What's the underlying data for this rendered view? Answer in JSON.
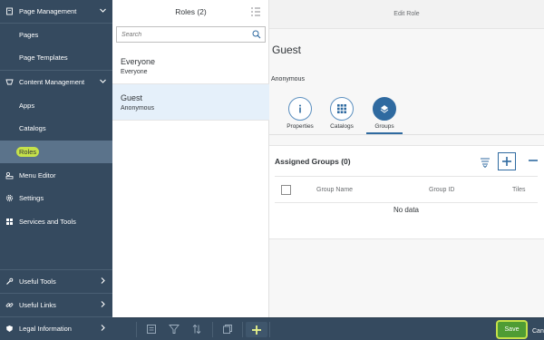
{
  "nav": {
    "items": [
      {
        "label": "Page Management",
        "icon": "page-icon",
        "type": "group",
        "expanded": true
      },
      {
        "label": "Pages",
        "type": "sub"
      },
      {
        "label": "Page Templates",
        "type": "sub"
      },
      {
        "label": "Content Management",
        "icon": "content-icon",
        "type": "group",
        "expanded": true
      },
      {
        "label": "Apps",
        "type": "sub"
      },
      {
        "label": "Catalogs",
        "type": "sub"
      },
      {
        "label": "Roles",
        "type": "sub",
        "active": true
      },
      {
        "label": "Menu Editor",
        "icon": "menu-editor-icon",
        "type": "item"
      },
      {
        "label": "Settings",
        "icon": "gear-icon",
        "type": "item"
      },
      {
        "label": "Services and Tools",
        "icon": "services-icon",
        "type": "item"
      }
    ],
    "bottom": [
      {
        "label": "Useful Tools",
        "icon": "wrench-icon"
      },
      {
        "label": "Useful Links",
        "icon": "link-icon"
      },
      {
        "label": "Legal Information",
        "icon": "legal-icon"
      }
    ]
  },
  "master": {
    "title": "Roles (2)",
    "search_placeholder": "Search",
    "roles": [
      {
        "title": "Everyone",
        "description": "Everyone",
        "selected": false
      },
      {
        "title": "Guest",
        "description": "Anonymous",
        "selected": true
      }
    ]
  },
  "detail": {
    "header": "Edit Role",
    "role_name": "Guest",
    "role_description": "Anonymous",
    "tabs": [
      {
        "label": "Properties",
        "icon": "info-icon",
        "active": false
      },
      {
        "label": "Catalogs",
        "icon": "grid-icon",
        "active": false
      },
      {
        "label": "Groups",
        "icon": "groups-icon",
        "active": true
      }
    ],
    "assigned_groups": {
      "title": "Assigned Groups (0)",
      "columns": [
        "Group Name",
        "Group ID",
        "Tiles"
      ],
      "empty_text": "No data"
    }
  },
  "footer": {
    "save_label": "Save",
    "cancel_label": "Cancel"
  },
  "colors": {
    "nav_bg": "#354a5f",
    "nav_active": "#5b738b",
    "accent": "#2f6aa0",
    "save_green": "#4f9c34",
    "highlight": "#c5e14a"
  }
}
